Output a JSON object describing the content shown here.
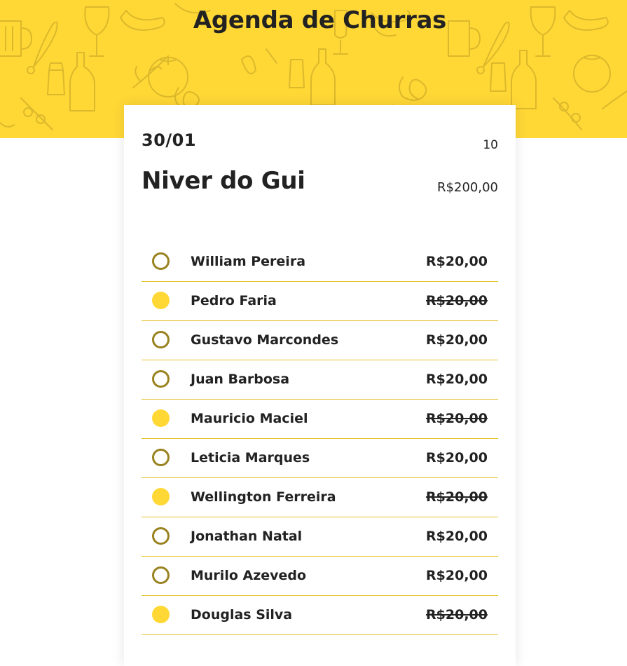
{
  "header": {
    "title": "Agenda de Churras",
    "background_color": "#FFD836",
    "pattern_icons": [
      "beer-mug-icon",
      "wine-glass-icon",
      "sausage-icon",
      "chicken-leg-icon",
      "salt-shaker-icon",
      "bottle-icon",
      "tomato-icon",
      "pretzel-icon",
      "herb-icon",
      "olive-icon"
    ]
  },
  "event": {
    "date": "30/01",
    "participant_count": "10",
    "name": "Niver do Gui",
    "total": "R$200,00"
  },
  "colors": {
    "accent": "#FFD836",
    "unpaid_ring": "#998220",
    "divider": "#E5C231",
    "text": "#222222"
  },
  "participants": [
    {
      "name": "William Pereira",
      "amount": "R$20,00",
      "paid": false
    },
    {
      "name": "Pedro Faria",
      "amount": "R$20,00",
      "paid": true
    },
    {
      "name": "Gustavo Marcondes",
      "amount": "R$20,00",
      "paid": false
    },
    {
      "name": "Juan Barbosa",
      "amount": "R$20,00",
      "paid": false
    },
    {
      "name": "Mauricio Maciel",
      "amount": "R$20,00",
      "paid": true
    },
    {
      "name": "Leticia Marques",
      "amount": "R$20,00",
      "paid": false
    },
    {
      "name": "Wellington Ferreira",
      "amount": "R$20,00",
      "paid": true
    },
    {
      "name": "Jonathan Natal",
      "amount": "R$20,00",
      "paid": false
    },
    {
      "name": "Murilo Azevedo",
      "amount": "R$20,00",
      "paid": false
    },
    {
      "name": "Douglas Silva",
      "amount": "R$20,00",
      "paid": true
    }
  ]
}
